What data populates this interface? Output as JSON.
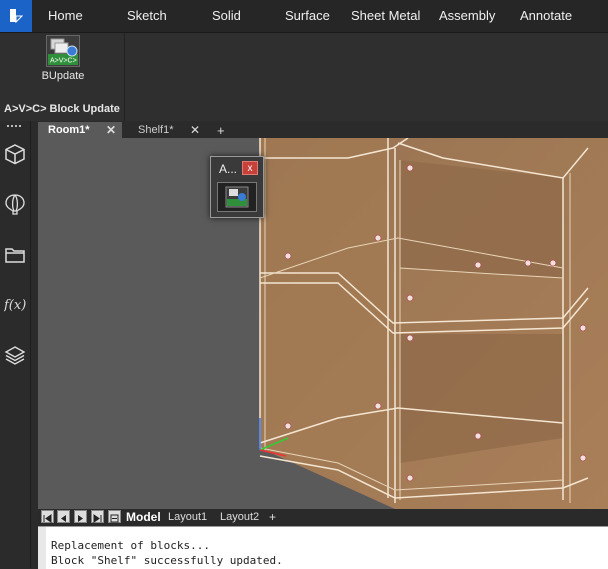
{
  "app": {
    "logo_icon": "bricscad-logo-icon",
    "accent": "#1c63c7"
  },
  "ribbon": {
    "tabs": [
      "Home",
      "Sketch",
      "Solid",
      "Surface",
      "Sheet Metal",
      "Assembly",
      "Annotate"
    ],
    "panel": {
      "button_label": "BUpdate",
      "button_icon_text": "A>V>C>",
      "group_title": "A>V>C> Block Update"
    }
  },
  "dock": {
    "icons": [
      "cube-icon",
      "balloon-icon",
      "folder-icon",
      "function-icon",
      "layers-icon"
    ],
    "function_label": "f(x)"
  },
  "documents": {
    "tabs": [
      {
        "label": "Room1*",
        "active": true
      },
      {
        "label": "Shelf1*",
        "active": false
      }
    ],
    "add_label": "+",
    "close_label": "✕"
  },
  "floating_toolbar": {
    "title": "A...",
    "close_label": "x"
  },
  "layouts": {
    "tabs": [
      "Model",
      "Layout1",
      "Layout2"
    ],
    "active": "Model",
    "add_label": "+"
  },
  "command_line": {
    "lines": [
      "Replacement of blocks...",
      "Block \"Shelf\" successfully updated."
    ]
  }
}
